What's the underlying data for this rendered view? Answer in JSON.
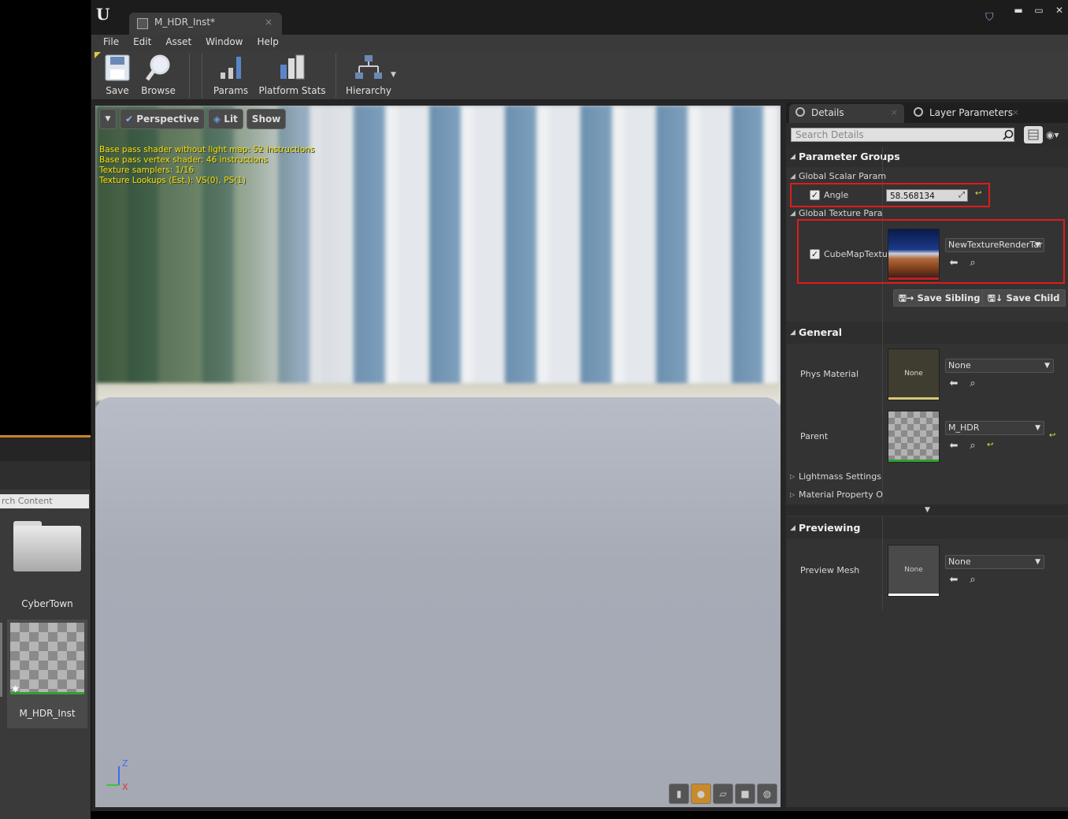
{
  "background_content_browser": {
    "search_placeholder": "rch Content",
    "folder_label": "CyberTown",
    "asset_label": "M_HDR_Inst"
  },
  "window": {
    "tab_title": "M_HDR_Inst*",
    "close_glyph": "×"
  },
  "menu": [
    "File",
    "Edit",
    "Asset",
    "Window",
    "Help"
  ],
  "toolbar": {
    "save": "Save",
    "browse": "Browse",
    "params": "Params",
    "platform_stats": "Platform Stats",
    "hierarchy": "Hierarchy"
  },
  "viewport": {
    "perspective": "Perspective",
    "lit": "Lit",
    "show": "Show",
    "stats": [
      "Base pass shader without light map: 52 instructions",
      "Base pass vertex shader: 46 instructions",
      "Texture samplers: 1/16",
      "Texture Lookups (Est.): VS(0), PS(1)"
    ],
    "axis_z": "Z",
    "axis_x": "X"
  },
  "details": {
    "tab_details": "Details",
    "tab_layer_params": "Layer Parameters",
    "search_placeholder": "Search Details",
    "parameter_groups": "Parameter Groups",
    "global_scalar": "Global Scalar Param",
    "angle_label": "Angle",
    "angle_value": "58.568134",
    "global_texture": "Global Texture Para",
    "cubemap_label": "CubeMapTextu",
    "cubemap_value": "NewTextureRenderTar",
    "save_sibling": "Save Sibling",
    "save_child": "Save Child",
    "general": "General",
    "phys_material_label": "Phys Material",
    "phys_material_thumb": "None",
    "phys_material_value": "None",
    "parent_label": "Parent",
    "parent_value": "M_HDR",
    "lightmass": "Lightmass Settings",
    "material_property": "Material Property O",
    "previewing": "Previewing",
    "preview_mesh_label": "Preview Mesh",
    "preview_mesh_thumb": "None",
    "preview_mesh_value": "None"
  },
  "colors": {
    "highlight": "#e01b1b",
    "stats_text": "#f2e200",
    "accent_orange": "#c8822a"
  }
}
